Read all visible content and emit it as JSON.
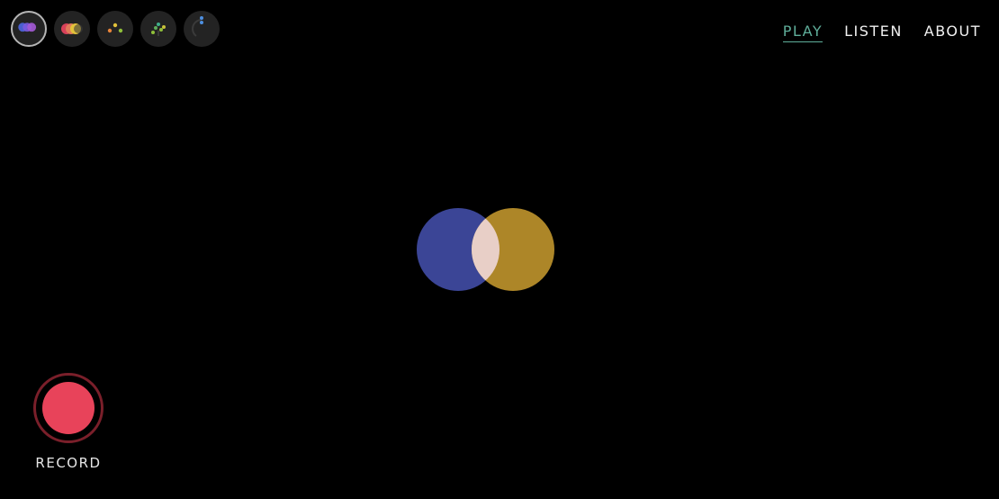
{
  "modes": [
    {
      "name": "circles",
      "active": true
    },
    {
      "name": "overlap",
      "active": false
    },
    {
      "name": "dots",
      "active": false
    },
    {
      "name": "bars",
      "active": false
    },
    {
      "name": "radial",
      "active": false
    }
  ],
  "nav": {
    "play": "PLAY",
    "listen": "LISTEN",
    "about": "ABOUT"
  },
  "record": {
    "label": "RECORD"
  },
  "colors": {
    "background": "#000000",
    "active_nav": "#5fae9a",
    "record": "#e8435a",
    "circle_left": "#3b4596",
    "circle_right": "#ad8628",
    "overlap": "#e8cfc7"
  }
}
